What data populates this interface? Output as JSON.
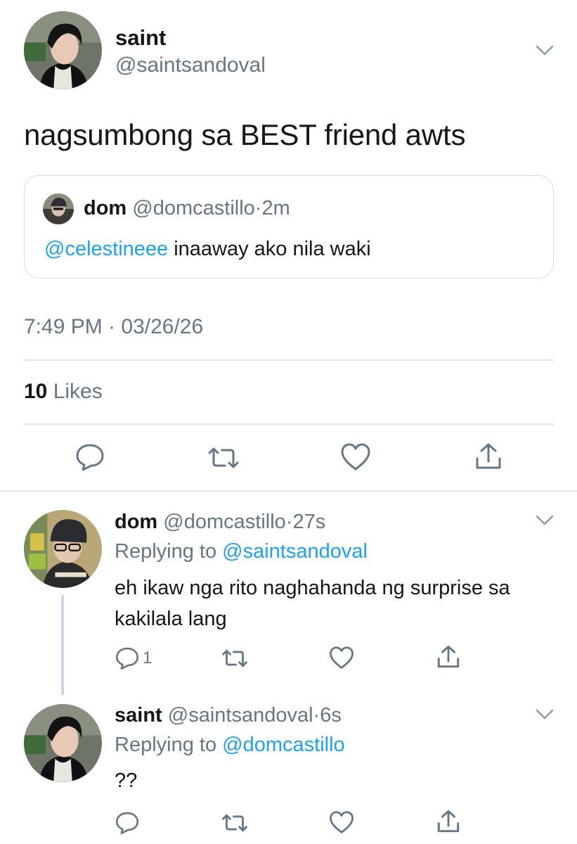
{
  "main_tweet": {
    "display_name": "saint",
    "handle": "@saintsandoval",
    "text": "nagsumbong sa BEST friend awts",
    "quote": {
      "display_name": "dom",
      "handle": "@domcastillo",
      "separator": "·",
      "time": "2m",
      "mention": "@celestineee",
      "text": " inaaway ako nila waki"
    },
    "timestamp": "7:49 PM · 03/26/26",
    "likes_count": "10",
    "likes_label": " Likes"
  },
  "replies": [
    {
      "display_name": "dom",
      "handle": "@domcastillo",
      "separator": "·",
      "time": "27s",
      "replying_label": "Replying to ",
      "replying_to": "@saintsandoval",
      "text": "eh ikaw nga rito naghahanda ng surprise sa kakilala lang",
      "reply_count": "1"
    },
    {
      "display_name": "saint",
      "handle": "@saintsandoval",
      "separator": "·",
      "time": "6s",
      "replying_label": "Replying to ",
      "replying_to": "@domcastillo",
      "text": "??",
      "reply_count": ""
    }
  ],
  "icons": {
    "reply": "reply-icon",
    "retweet": "retweet-icon",
    "like": "heart-icon",
    "share": "share-icon",
    "more": "chevron-down-icon"
  },
  "colors": {
    "link": "#1da1f2",
    "muted": "#657786",
    "text": "#14171a",
    "divider": "#e1e8ed"
  }
}
